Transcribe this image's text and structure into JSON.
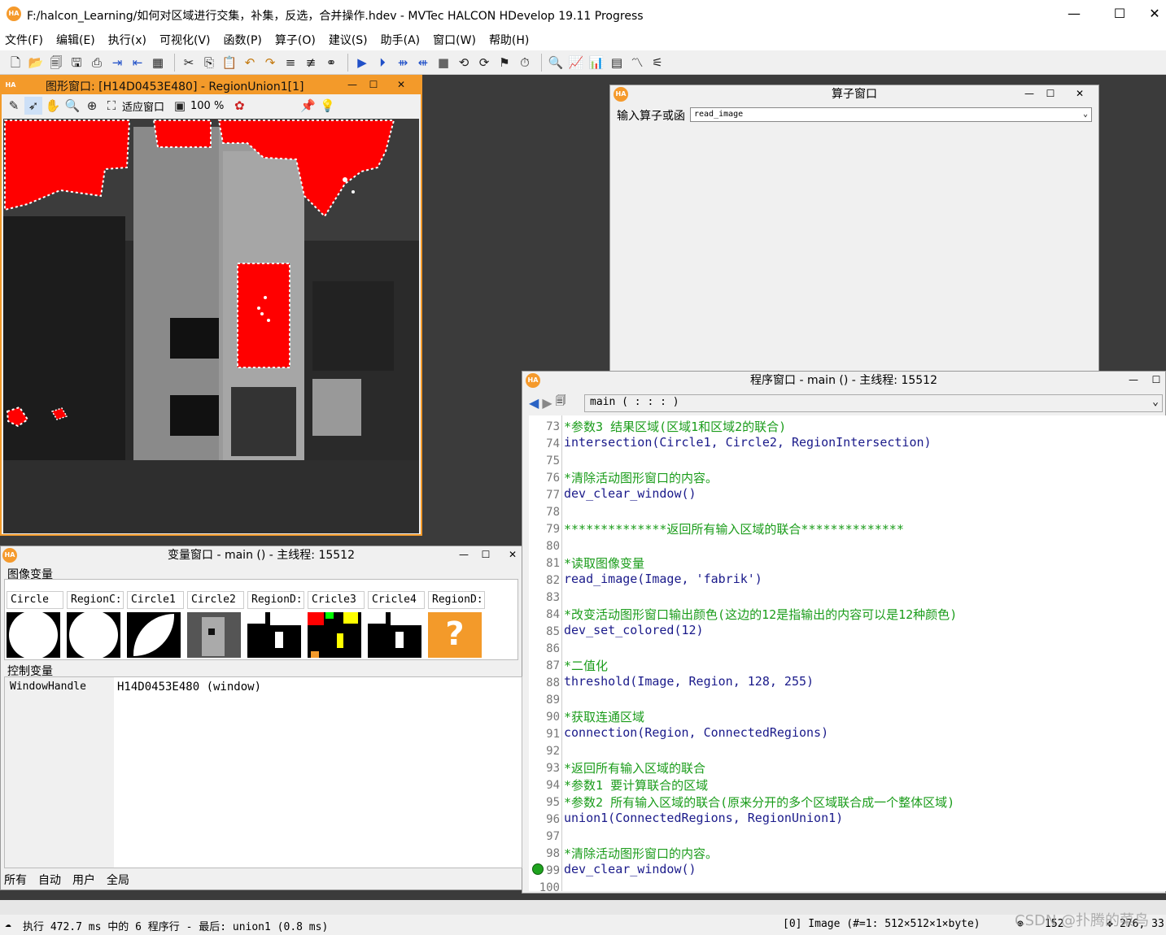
{
  "window": {
    "title": "F:/halcon_Learning/如何对区域进行交集，补集，反选，合并操作.hdev - MVTec HALCON HDevelop 19.11 Progress",
    "minimize": "—",
    "maximize": "☐",
    "close": "✕"
  },
  "menu": [
    "文件(F)",
    "编辑(E)",
    "执行(x)",
    "可视化(V)",
    "函数(P)",
    "算子(O)",
    "建议(S)",
    "助手(A)",
    "窗口(W)",
    "帮助(H)"
  ],
  "graphics_window": {
    "title": "图形窗口: [H14D0453E480] - RegionUnion1[1]",
    "fit_label": "适应窗口",
    "zoom_label": "100 %"
  },
  "operator_window": {
    "title": "算子窗口",
    "input_label": "输入算子或函",
    "input_value": "read_image"
  },
  "program_window": {
    "title": "程序窗口 - main () - 主线程: 15512",
    "procedure": "main ( : : : )",
    "lines": [
      {
        "num": "73",
        "text": "*参数3 结果区域(区域1和区域2的联合)",
        "type": "c"
      },
      {
        "num": "74",
        "text": "intersection(Circle1, Circle2, RegionIntersection)",
        "type": "k"
      },
      {
        "num": "75",
        "text": "",
        "type": "k"
      },
      {
        "num": "76",
        "text": "*清除活动图形窗口的内容。",
        "type": "c"
      },
      {
        "num": "77",
        "text": "dev_clear_window()",
        "type": "k"
      },
      {
        "num": "78",
        "text": "",
        "type": "k"
      },
      {
        "num": "79",
        "text": "**************返回所有输入区域的联合**************",
        "type": "c"
      },
      {
        "num": "80",
        "text": "",
        "type": "k"
      },
      {
        "num": "81",
        "text": "*读取图像变量",
        "type": "c"
      },
      {
        "num": "82",
        "text": "read_image(Image, 'fabrik')",
        "type": "k"
      },
      {
        "num": "83",
        "text": "",
        "type": "k"
      },
      {
        "num": "84",
        "text": "*改变活动图形窗口输出颜色(这边的12是指输出的内容可以是12种颜色)",
        "type": "c"
      },
      {
        "num": "85",
        "text": "dev_set_colored(12)",
        "type": "k"
      },
      {
        "num": "86",
        "text": "",
        "type": "k"
      },
      {
        "num": "87",
        "text": "*二值化",
        "type": "c"
      },
      {
        "num": "88",
        "text": "threshold(Image, Region, 128, 255)",
        "type": "k"
      },
      {
        "num": "89",
        "text": "",
        "type": "k"
      },
      {
        "num": "90",
        "text": "*获取连通区域",
        "type": "c"
      },
      {
        "num": "91",
        "text": "connection(Region, ConnectedRegions)",
        "type": "k"
      },
      {
        "num": "92",
        "text": "",
        "type": "k"
      },
      {
        "num": "93",
        "text": "*返回所有输入区域的联合",
        "type": "c"
      },
      {
        "num": "94",
        "text": "*参数1 要计算联合的区域",
        "type": "c"
      },
      {
        "num": "95",
        "text": "*参数2 所有输入区域的联合(原来分开的多个区域联合成一个整体区域)",
        "type": "c"
      },
      {
        "num": "96",
        "text": "union1(ConnectedRegions, RegionUnion1)",
        "type": "k"
      },
      {
        "num": "97",
        "text": "",
        "type": "k"
      },
      {
        "num": "98",
        "text": "*清除活动图形窗口的内容。",
        "type": "c"
      },
      {
        "num": "99",
        "text": "dev_clear_window()",
        "type": "k"
      },
      {
        "num": "100",
        "text": "",
        "type": "k"
      }
    ]
  },
  "variable_window": {
    "title": "变量窗口 - main () - 主线程: 15512",
    "image_section": "图像变量",
    "image_vars": [
      "Circle",
      "RegionC:",
      "Circle1",
      "Circle2",
      "RegionD:",
      "Cricle3",
      "Cricle4",
      "RegionD:"
    ],
    "control_section": "控制变量",
    "control_vars": [
      {
        "name": "WindowHandle",
        "value": "H14D0453E480 (window)"
      }
    ],
    "tabs": [
      "所有",
      "自动",
      "用户",
      "全局"
    ]
  },
  "status": {
    "left": "执行 472.7 ms 中的 6 程序行 - 最后: union1 (0.8 ms)",
    "right": "[0] Image (#=1: 512×512×1×byte)",
    "num1": "152",
    "num2": "276, 33"
  },
  "watermark": "CSDN @扑腾的菜鸟",
  "colors": {
    "accent": "#f39a2a",
    "region": "#ff0000",
    "code_comment": "#1a9c1a",
    "code_keyword": "#1a1a8a"
  }
}
